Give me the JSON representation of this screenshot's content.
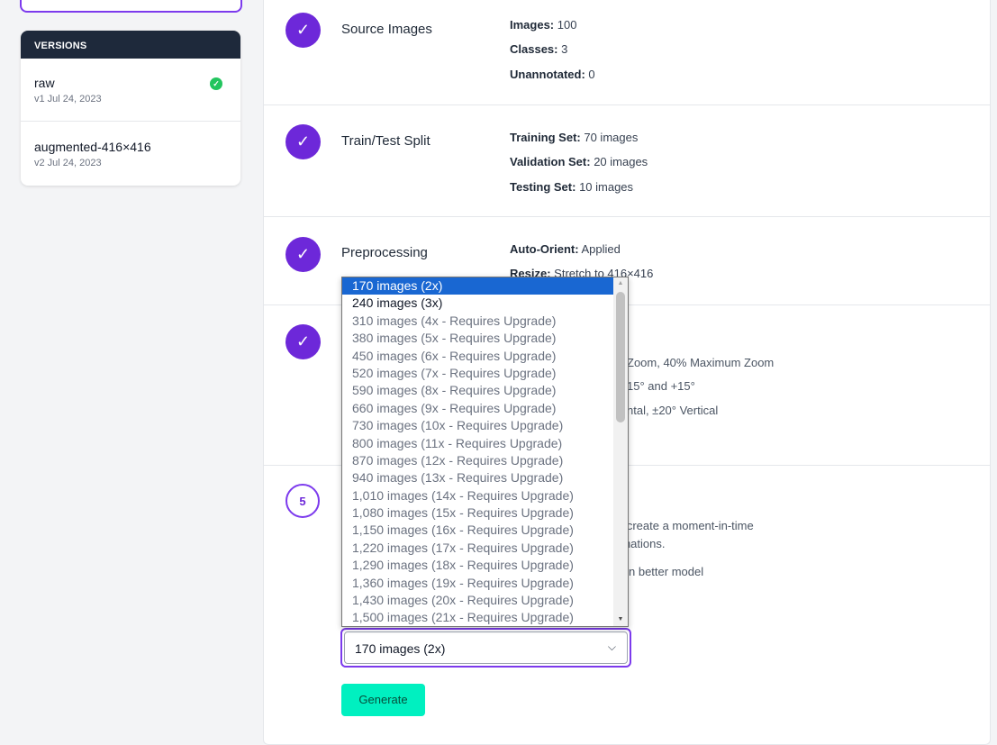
{
  "sidebar": {
    "versions_header": "VERSIONS",
    "versions": [
      {
        "name": "raw",
        "sub": "v1 Jul 24, 2023",
        "check": "✓"
      },
      {
        "name": "augmented-416×416",
        "sub": "v2 Jul 24, 2023"
      }
    ]
  },
  "steps": {
    "source": {
      "check": "✓",
      "title": "Source Images",
      "details": [
        {
          "label": "Images:",
          "value": "100"
        },
        {
          "label": "Classes:",
          "value": "3"
        },
        {
          "label": "Unannotated:",
          "value": "0"
        }
      ]
    },
    "split": {
      "check": "✓",
      "title": "Train/Test Split",
      "details": [
        {
          "label": "Training Set:",
          "value": "70 images"
        },
        {
          "label": "Validation Set:",
          "value": "20 images"
        },
        {
          "label": "Testing Set:",
          "value": "10 images"
        }
      ]
    },
    "preprocessing": {
      "check": "✓",
      "title": "Preprocessing",
      "details": [
        {
          "label": "Auto-Orient:",
          "value": "Applied"
        },
        {
          "label": "Resize:",
          "value": "Stretch to 416×416"
        }
      ]
    },
    "augmentation": {
      "check": "✓",
      "visible_text": [
        "Zoom, 40% Maximum Zoom",
        "15° and +15°",
        "ntal, ±20° Vertical"
      ]
    },
    "generate": {
      "number": "5",
      "visible_text": [
        "o create a moment-in-time",
        "rmations.",
        "lt in better model"
      ],
      "selected_value": "170 images (2x)",
      "chevron": "⌵",
      "button_label": "Generate"
    }
  },
  "dropdown": {
    "selected_index": 0,
    "options": [
      "170 images (2x)",
      "240 images (3x)",
      "310 images (4x - Requires Upgrade)",
      "380 images (5x - Requires Upgrade)",
      "450 images (6x - Requires Upgrade)",
      "520 images (7x - Requires Upgrade)",
      "590 images (8x - Requires Upgrade)",
      "660 images (9x - Requires Upgrade)",
      "730 images (10x - Requires Upgrade)",
      "800 images (11x - Requires Upgrade)",
      "870 images (12x - Requires Upgrade)",
      "940 images (13x - Requires Upgrade)",
      "1,010 images (14x - Requires Upgrade)",
      "1,080 images (15x - Requires Upgrade)",
      "1,150 images (16x - Requires Upgrade)",
      "1,220 images (17x - Requires Upgrade)",
      "1,290 images (18x - Requires Upgrade)",
      "1,360 images (19x - Requires Upgrade)",
      "1,430 images (20x - Requires Upgrade)",
      "1,500 images (21x - Requires Upgrade)"
    ],
    "enabled_count": 2,
    "scroll_up": "▲",
    "scroll_down": "▼"
  },
  "colors": {
    "accent": "#6d28d9",
    "success": "#22c55e",
    "generate": "#00f0c0",
    "selected_option": "#1967d2"
  }
}
